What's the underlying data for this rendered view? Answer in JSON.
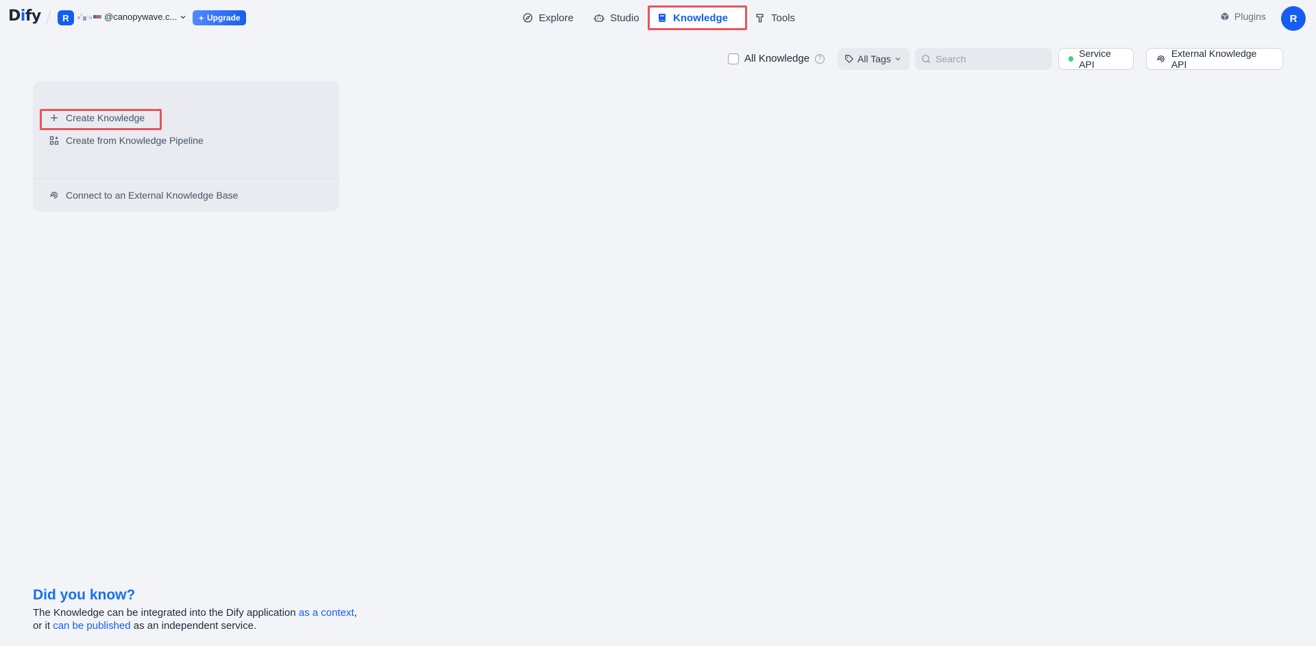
{
  "header": {
    "logo_left": "D",
    "logo_i": "i",
    "logo_right": "fy",
    "workspace_initial": "R",
    "workspace_name": "@canopywave.c...",
    "upgrade_label": "Upgrade",
    "nav": [
      {
        "label": "Explore",
        "icon": "compass-icon"
      },
      {
        "label": "Studio",
        "icon": "robot-icon"
      },
      {
        "label": "Knowledge",
        "icon": "book-icon",
        "active": true
      },
      {
        "label": "Tools",
        "icon": "hammer-icon"
      }
    ],
    "plugins_label": "Plugins",
    "user_initial": "R"
  },
  "toolbar": {
    "all_knowledge_label": "All Knowledge",
    "all_tags_label": "All Tags",
    "search_placeholder": "Search",
    "service_api_label": "Service API",
    "external_api_label": "External Knowledge API"
  },
  "create_card": {
    "create_label": "Create Knowledge",
    "pipeline_label": "Create from Knowledge Pipeline",
    "external_label": "Connect to an External Knowledge Base"
  },
  "tip": {
    "title": "Did you know?",
    "line1_before": "The Knowledge can be integrated into the Dify application ",
    "line1_link": "as a context",
    "line1_after": ",",
    "line2_before": "or it ",
    "line2_link": "can be published",
    "line2_after": " as an independent service."
  },
  "colors": {
    "accent": "#155eef",
    "highlight_box": "#e9545c",
    "status_dot": "#32d583"
  }
}
